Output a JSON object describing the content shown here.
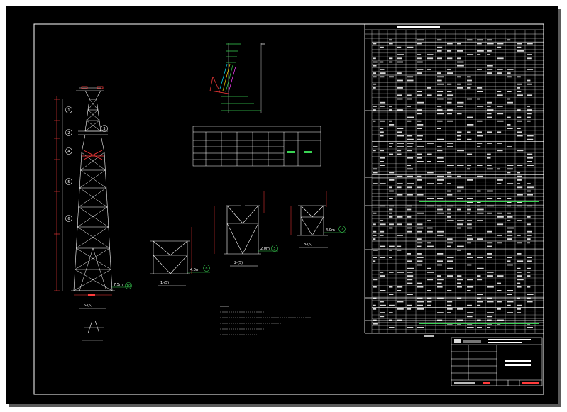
{
  "colors": {
    "paper": "#000000",
    "line": "#ffffff",
    "dim": "#ff3b3b",
    "green": "#39d353",
    "cyan": "#00e5ff",
    "yellow": "#ffd400",
    "magenta": "#ff40ff"
  },
  "tower": {
    "section_marks": [
      "1",
      "2",
      "3",
      "4",
      "5",
      "6"
    ],
    "base_label": "7.5m",
    "base_mark": "10",
    "caption": "5-(5)"
  },
  "details": {
    "d1": {
      "level": "4.0m",
      "mark": "8",
      "caption": "1-(5)"
    },
    "d2": {
      "level": "2.0m",
      "mark": "5",
      "caption": "2-(5)"
    },
    "d3": {
      "level": "4.0m",
      "mark": "7",
      "caption": "3-(5)"
    }
  },
  "spec_table": {
    "headers": [
      "",
      "",
      "",
      "",
      "",
      ""
    ],
    "rows": [
      [
        "",
        "",
        "",
        "",
        ""
      ],
      [
        "",
        "",
        "",
        "",
        ""
      ],
      [
        "",
        "",
        "",
        "",
        ""
      ],
      [
        "",
        "",
        "",
        "",
        ""
      ]
    ]
  },
  "title_block": {
    "drawing_no": "",
    "sheet": ""
  }
}
